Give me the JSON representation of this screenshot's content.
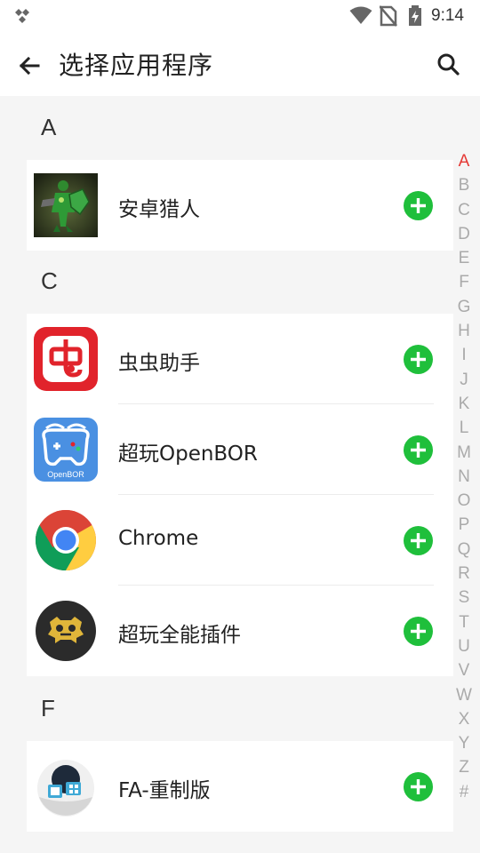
{
  "status_bar": {
    "time": "9:14",
    "icons": [
      "app-notification-icon",
      "wifi-icon",
      "no-sim-icon",
      "battery-charging-icon"
    ]
  },
  "toolbar": {
    "title": "选择应用程序",
    "back_icon": "arrow-left-icon",
    "search_icon": "search-icon"
  },
  "sections": [
    {
      "letter": "A",
      "apps": [
        {
          "name": "安卓猎人",
          "icon": "android-hunter-icon"
        }
      ]
    },
    {
      "letter": "C",
      "apps": [
        {
          "name": "虫虫助手",
          "icon": "chongchong-icon"
        },
        {
          "name": "超玩OpenBOR",
          "icon": "openbor-icon",
          "icon_text": "OpenBOR"
        },
        {
          "name": "Chrome",
          "icon": "chrome-icon"
        },
        {
          "name": "超玩全能插件",
          "icon": "plugin-icon"
        }
      ]
    },
    {
      "letter": "F",
      "apps": [
        {
          "name": "FA-重制版",
          "icon": "fa-remake-icon"
        }
      ]
    }
  ],
  "index_bar": {
    "letters": [
      "A",
      "B",
      "C",
      "D",
      "E",
      "F",
      "G",
      "H",
      "I",
      "J",
      "K",
      "L",
      "M",
      "N",
      "O",
      "P",
      "Q",
      "R",
      "S",
      "T",
      "U",
      "V",
      "W",
      "X",
      "Y",
      "Z",
      "#"
    ],
    "active": "A"
  },
  "colors": {
    "accent_add": "#1fbf3b",
    "index_active": "#e53935",
    "index_inactive": "#aaaaaa",
    "background": "#f5f5f5"
  }
}
